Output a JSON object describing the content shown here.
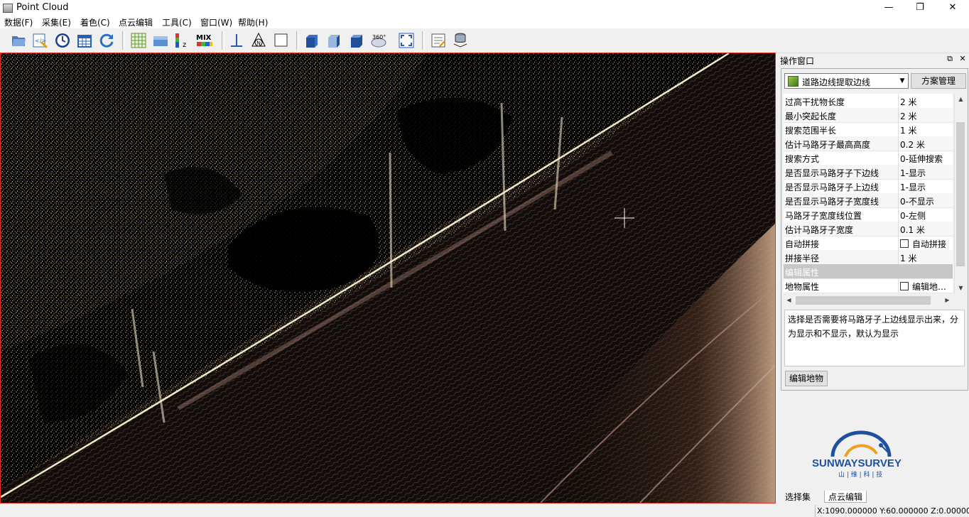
{
  "window": {
    "title": "Point Cloud",
    "minimize": "—",
    "restore": "❐",
    "close": "✕"
  },
  "menu": [
    "数据(F)",
    "采集(E)",
    "着色(C)",
    "点云编辑",
    "工具(C)",
    "窗口(W)",
    "帮助(H)"
  ],
  "toolbar": {
    "icons": [
      "open-folder-icon",
      "script-icon",
      "clock-icon",
      "calendar-icon",
      "refresh-icon",
      "grid-icon",
      "flat-color-icon",
      "elevation-color-icon",
      "mix-color-icon",
      "measure-icon",
      "north-arrow-icon",
      "blank-square-icon",
      "view-front-icon",
      "view-side-icon",
      "view-top-icon",
      "view-360-icon",
      "fit-view-icon",
      "notes-icon",
      "layers-icon"
    ],
    "mix_label": "MIX",
    "z_label": "z",
    "n_label": "N",
    "view360_label": "360°"
  },
  "panel": {
    "title": "操作窗口",
    "pin": "⧉",
    "close": "✕",
    "tool_select": "道路边线提取边线",
    "manage_button": "方案管理",
    "properties": [
      {
        "name": "过高干扰物长度",
        "value": "2  米"
      },
      {
        "name": "最小突起长度",
        "value": "2  米"
      },
      {
        "name": "搜索范围半长",
        "value": "1  米"
      },
      {
        "name": "估计马路牙子最高高度",
        "value": "0.2  米"
      },
      {
        "name": "搜索方式",
        "value": "0-延伸搜索"
      },
      {
        "name": "是否显示马路牙子下边线",
        "value": "1-显示"
      },
      {
        "name": "是否显示马路牙子上边线",
        "value": "1-显示"
      },
      {
        "name": "是否显示马路牙子宽度线",
        "value": "0-不显示"
      },
      {
        "name": "马路牙子宽度线位置",
        "value": "0-左侧"
      },
      {
        "name": "估计马路牙子宽度",
        "value": "0.1  米"
      },
      {
        "name": "自动拼接",
        "value": "自动拼接",
        "checkbox": true
      },
      {
        "name": "拼接半径",
        "value": "1  米"
      },
      {
        "name": "编辑属性",
        "value": "",
        "section": true
      },
      {
        "name": "地物属性",
        "value": "编辑地…",
        "checkbox": true
      }
    ],
    "description": "选择是否需要将马路牙子上边线显示出来，分为显示和不显示，默认为显示",
    "edit_button": "编辑地物"
  },
  "tabs": [
    "选择集",
    "点云编辑"
  ],
  "status": "X:1090.000000 Y:60.000000 Z:0.000000",
  "logo": {
    "name": "SUNWAYSURVEY",
    "sub": "山 | 维 | 科 | 技"
  }
}
